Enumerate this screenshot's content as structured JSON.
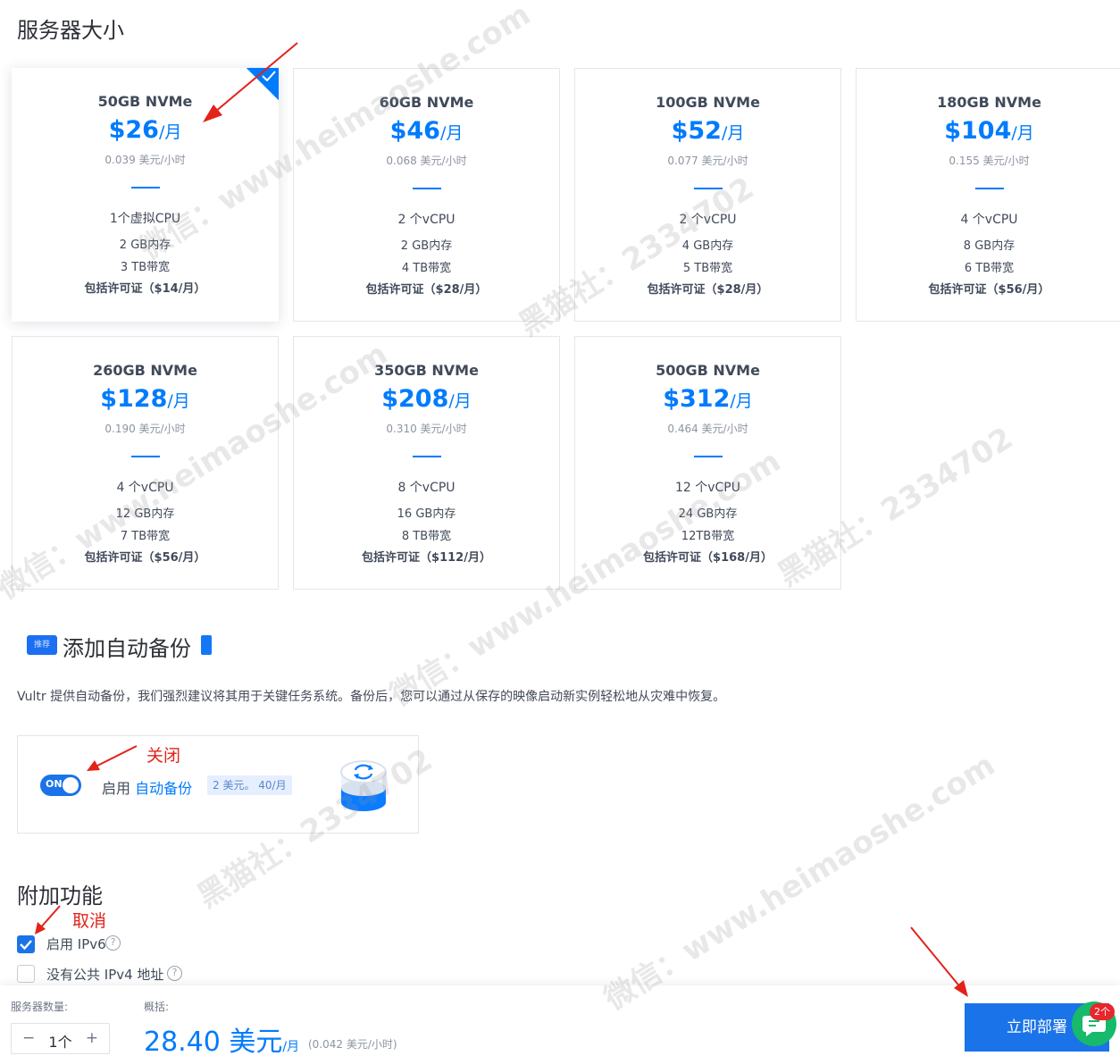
{
  "server_size": {
    "title": "服务器大小",
    "plans": [
      {
        "name": "50GB NVMe",
        "price": "$26",
        "per": "/月",
        "hourly": "0.039 美元/小时",
        "cpu": "1个虚拟CPU",
        "ram": "2 GB内存",
        "bandwidth": "3 TB带宽",
        "license": "包括许可证（$14/月）",
        "selected": true
      },
      {
        "name": "60GB NVMe",
        "price": "$46",
        "per": "/月",
        "hourly": "0.068 美元/小时",
        "cpu": "2 个vCPU",
        "ram": "2 GB内存",
        "bandwidth": "4 TB带宽",
        "license": "包括许可证（$28/月）",
        "selected": false
      },
      {
        "name": "100GB NVMe",
        "price": "$52",
        "per": "/月",
        "hourly": "0.077 美元/小时",
        "cpu": "2 个vCPU",
        "ram": "4 GB内存",
        "bandwidth": "5 TB带宽",
        "license": "包括许可证（$28/月）",
        "selected": false
      },
      {
        "name": "180GB NVMe",
        "price": "$104",
        "per": "/月",
        "hourly": "0.155 美元/小时",
        "cpu": "4 个vCPU",
        "ram": "8 GB内存",
        "bandwidth": "6 TB带宽",
        "license": "包括许可证（$56/月）",
        "selected": false
      },
      {
        "name": "260GB NVMe",
        "price": "$128",
        "per": "/月",
        "hourly": "0.190 美元/小时",
        "cpu": "4 个vCPU",
        "ram": "12 GB内存",
        "bandwidth": "7 TB带宽",
        "license": "包括许可证（$56/月）",
        "selected": false
      },
      {
        "name": "350GB NVMe",
        "price": "$208",
        "per": "/月",
        "hourly": "0.310 美元/小时",
        "cpu": "8 个vCPU",
        "ram": "16 GB内存",
        "bandwidth": "8 TB带宽",
        "license": "包括许可证（$112/月）",
        "selected": false
      },
      {
        "name": "500GB NVMe",
        "price": "$312",
        "per": "/月",
        "hourly": "0.464 美元/小时",
        "cpu": "12 个vCPU",
        "ram": "24 GB内存",
        "bandwidth": "12TB带宽",
        "license": "包括许可证（$168/月）",
        "selected": false
      }
    ]
  },
  "backup": {
    "tag": "推荐",
    "title": "添加自动备份",
    "description": "Vultr 提供自动备份，我们强烈建议将其用于关键任务系统。备份后，您可以通过从保存的映像启动新实例轻松地从灾难中恢复。",
    "toggle_label": "ON",
    "toggle_on": true,
    "enable_prefix": "启用",
    "enable_link": "自动备份",
    "price_chip": "2 美元。 40/月"
  },
  "annotations": {
    "close": "关闭",
    "cancel": "取消"
  },
  "addons": {
    "title": "附加功能",
    "items": [
      {
        "label": "启用 IPv6",
        "checked": true
      },
      {
        "label": "没有公共 IPv4 地址",
        "checked": false
      }
    ],
    "help_glyph": "?"
  },
  "footer": {
    "qty_label": "服务器数量:",
    "qty_value": "1个",
    "minus": "−",
    "plus": "+",
    "summary_label": "概括:",
    "total": "28.40 美元",
    "total_per": "/月",
    "hourly": "(0.042 美元/小时)",
    "deploy_label": "立即部署",
    "chat_badge": "2个"
  },
  "watermark": {
    "line1": "黑猫社：2334702",
    "line2": "微信：www.heimaoshe.com"
  },
  "colors": {
    "accent": "#007bfc",
    "button": "#1a73e8",
    "annotation": "#e2231a",
    "chat": "#17b96b",
    "badge": "#e8262b"
  }
}
